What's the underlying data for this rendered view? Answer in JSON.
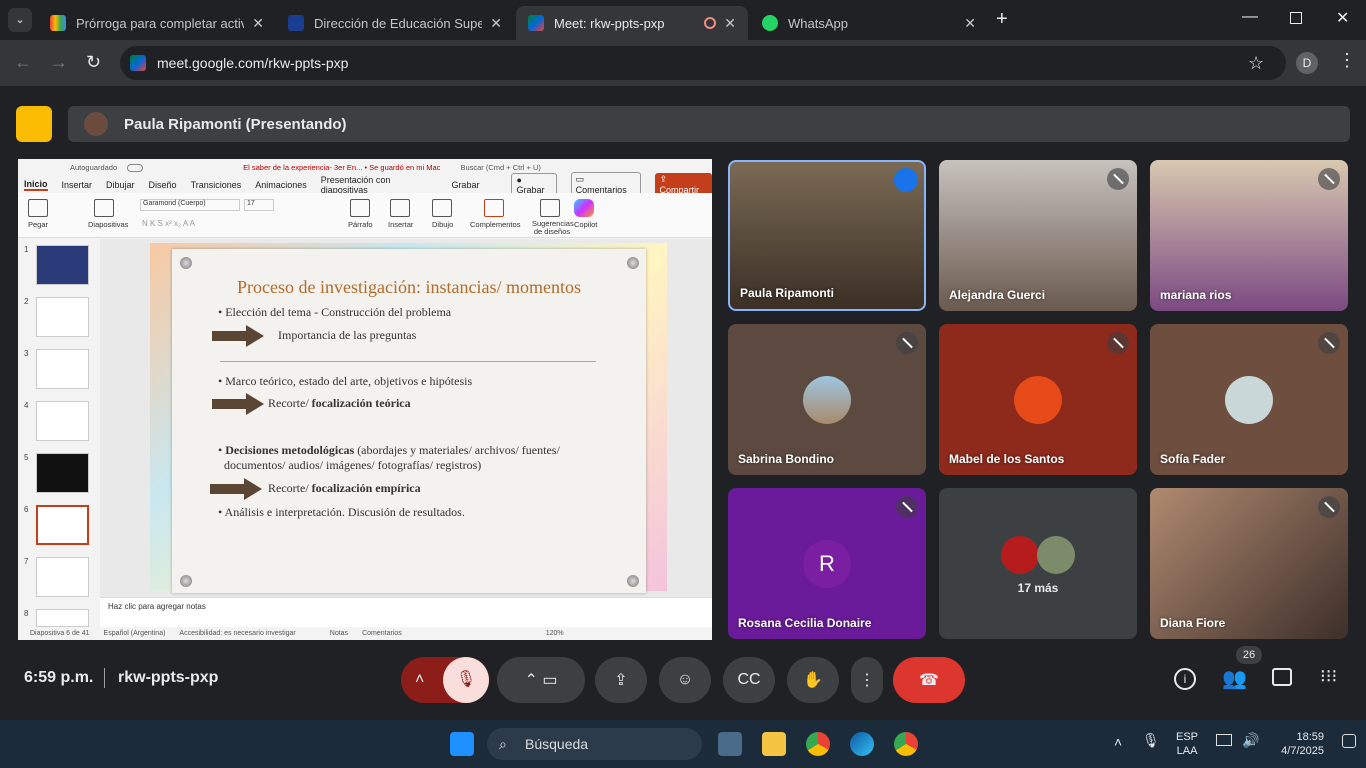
{
  "browser": {
    "tabs": [
      {
        "title": "Prórroga para completar activid",
        "icon": "gmail-icon"
      },
      {
        "title": "Dirección de Educación Superio",
        "icon": "site-icon"
      },
      {
        "title": "Meet: rkw-ppts-pxp",
        "icon": "meet-icon"
      },
      {
        "title": "WhatsApp",
        "icon": "whatsapp-icon"
      }
    ],
    "url": "meet.google.com/rkw-ppts-pxp",
    "profile_initial": "D"
  },
  "presentation_bar": {
    "presenter": "Paula Ripamonti (Presentando)"
  },
  "ppt": {
    "autosave": "Autoguardado",
    "doc_title": "El saber de la experiencia- 3er En... • Se guardó en mi Mac",
    "search": "Buscar (Cmd + Ctrl + U)",
    "tabs": [
      "Inicio",
      "Insertar",
      "Dibujar",
      "Diseño",
      "Transiciones",
      "Animaciones",
      "Presentación con diapositivas",
      "Grabar"
    ],
    "record_label": "Grabar",
    "comments_label": "Comentarios",
    "share_label": "Compartir",
    "font": "Garamond (Cuerpo)",
    "font_size": "17",
    "ribbon": {
      "paste": "Pegar",
      "slides": "Diapositivas",
      "paragraph": "Párrafo",
      "insert": "Insertar",
      "draw": "Dibujo",
      "addins": "Complementos",
      "designer": "Sugerencias de diseños",
      "copilot": "Copilot"
    },
    "thumb_numbers": [
      "1",
      "2",
      "3",
      "4",
      "5",
      "6",
      "7",
      "8"
    ],
    "slide": {
      "title": "Proceso de investigación: instancias/ momentos",
      "b1": "Elección del tema - Construcción del problema",
      "a1": "Importancia de las preguntas",
      "b2": "Marco teórico, estado del arte, objetivos e hipótesis",
      "a2_pre": "Recorte/",
      "a2_bold": "focalización teórica",
      "b3_bold": "Decisiones metodológicas",
      "b3_rest": "(abordajes y materiales/ archivos/ fuentes/",
      "b3_line2": "documentos/ audios/ imágenes/ fotografías/ registros)",
      "a3_pre": "Recorte/",
      "a3_bold": "focalización empírica",
      "b4": "Análisis e interpretación. Discusión de resultados."
    },
    "notes": "Haz clic para agregar notas",
    "status": {
      "slide": "Diapositiva 6 de 41",
      "lang": "Español (Argentina)",
      "access": "Accesibilidad: es necesario investigar",
      "notes": "Notas",
      "comments": "Comentarios",
      "zoom": "120%"
    }
  },
  "participants": [
    {
      "name": "Paula Ripamonti"
    },
    {
      "name": "Alejandra Guerci"
    },
    {
      "name": "mariana rios"
    },
    {
      "name": "Sabrina Bondino"
    },
    {
      "name": "Mabel de los Santos"
    },
    {
      "name": "Sofía Fader"
    },
    {
      "name": "Rosana Cecilia Donaire",
      "initial": "R"
    },
    {
      "name": "17 más"
    },
    {
      "name": "Diana Fiore"
    }
  ],
  "meeting": {
    "time": "6:59 p.m.",
    "code": "rkw-ppts-pxp",
    "people_count": "26"
  },
  "taskbar": {
    "search": "Búsqueda",
    "lang": "ESP",
    "layout": "LAA",
    "clock": "18:59",
    "date": "4/7/2025"
  }
}
